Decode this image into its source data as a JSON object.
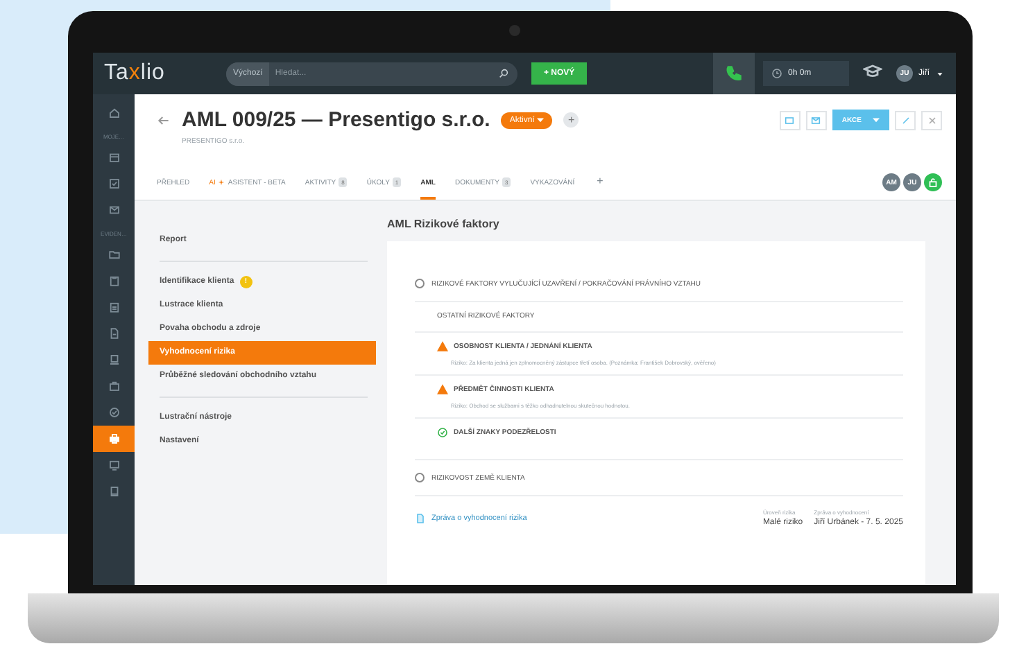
{
  "topbar": {
    "logo_left": "Ta",
    "logo_accent": "x",
    "logo_right": "lio",
    "search": {
      "scope": "Výchozí",
      "placeholder": "Hledat..."
    },
    "new_button": "+ NOVÝ",
    "timer": "0h 0m",
    "user": {
      "initials": "JU",
      "name": "Jiří"
    }
  },
  "rail": {
    "top_items": [
      {
        "selected": false
      }
    ],
    "sections": [
      {
        "label": "MOJE…",
        "items": [
          {
            "selected": false
          },
          {
            "selected": false
          },
          {
            "selected": false
          }
        ]
      },
      {
        "label": "EVIDEN…",
        "items": [
          {
            "selected": false
          },
          {
            "selected": false
          },
          {
            "selected": false
          },
          {
            "selected": false
          },
          {
            "selected": false
          },
          {
            "selected": false
          },
          {
            "selected": false
          },
          {
            "selected": true
          },
          {
            "selected": false
          },
          {
            "selected": false
          }
        ]
      }
    ]
  },
  "header": {
    "title": "AML 009/25 — Presentigo s.r.o.",
    "status": "Aktivní",
    "add_button": "+",
    "subtitle": "PRESENTIGO s.r.o.",
    "action_button": "AKCE"
  },
  "tabs": [
    {
      "kind": "plain",
      "label": "PŘEHLED",
      "selected": false
    },
    {
      "kind": "ai",
      "prefix": "AI",
      "label": "ASISTENT - BETA",
      "selected": false
    },
    {
      "kind": "count",
      "label": "AKTIVITY",
      "count": "8",
      "selected": false
    },
    {
      "kind": "count",
      "label": "ÚKOLY",
      "count": "1",
      "selected": false
    },
    {
      "kind": "plain",
      "label": "AML",
      "selected": true
    },
    {
      "kind": "count",
      "label": "DOKUMENTY",
      "count": "3",
      "selected": false
    },
    {
      "kind": "plain",
      "label": "VYKAZOVÁNÍ",
      "selected": false
    },
    {
      "kind": "add",
      "label": "+",
      "selected": false
    }
  ],
  "avatars": [
    "AM",
    "JU"
  ],
  "menu": [
    [
      {
        "label": "Report",
        "selected": false
      }
    ],
    [
      {
        "label": "Identifikace klienta",
        "badge": "!",
        "selected": false
      },
      {
        "label": "Lustrace klienta",
        "selected": false
      },
      {
        "label": "Povaha obchodu a zdroje",
        "selected": false
      },
      {
        "label": "Vyhodnocení rizika",
        "selected": true
      },
      {
        "label": "Průběžné sledování obchodního vztahu",
        "selected": false
      }
    ],
    [
      {
        "label": "Lustrační nástroje",
        "selected": false
      },
      {
        "label": "Nastavení",
        "selected": false
      }
    ]
  ],
  "main": {
    "title": "AML Rizikové faktory",
    "sections": [
      {
        "kind": "radio",
        "label": "RIZIKOVÉ FAKTORY VYLUČUJÍCÍ UZAVŘENÍ / POKRAČOVÁNÍ PRÁVNÍHO VZTAHU",
        "checked": false
      },
      {
        "kind": "group",
        "label": "OSTATNÍ RIZIKOVÉ FAKTORY",
        "items": [
          {
            "kind": "warning",
            "label": "OSOBNOST KLIENTA / JEDNÁNÍ KLIENTA",
            "note": "Riziko: Za klienta jedná jen zplnomocněný zástupce třetí osoba. (Poznámka: František Dobrovský, ověřeno)"
          },
          {
            "kind": "warning",
            "label": "PŘEDMĚT ČINNOSTI KLIENTA",
            "note": "Riziko: Obchod se službami s těžko odhadnutelnou skutečnou hodnotou."
          },
          {
            "kind": "ok",
            "label": "DALŠÍ ZNAKY PODEZŘELOSTI"
          }
        ]
      },
      {
        "kind": "radio",
        "label": "RIZIKOVOST ZEMĚ KLIENTA",
        "checked": false
      }
    ],
    "report": {
      "label": "Zpráva o vyhodnocení rizika",
      "level_caption": "Úroveň rizika",
      "level": "Malé riziko",
      "author_caption": "Zpráva o vyhodnocení",
      "author": "Jiří Urbánek - 7. 5. 2025"
    }
  }
}
